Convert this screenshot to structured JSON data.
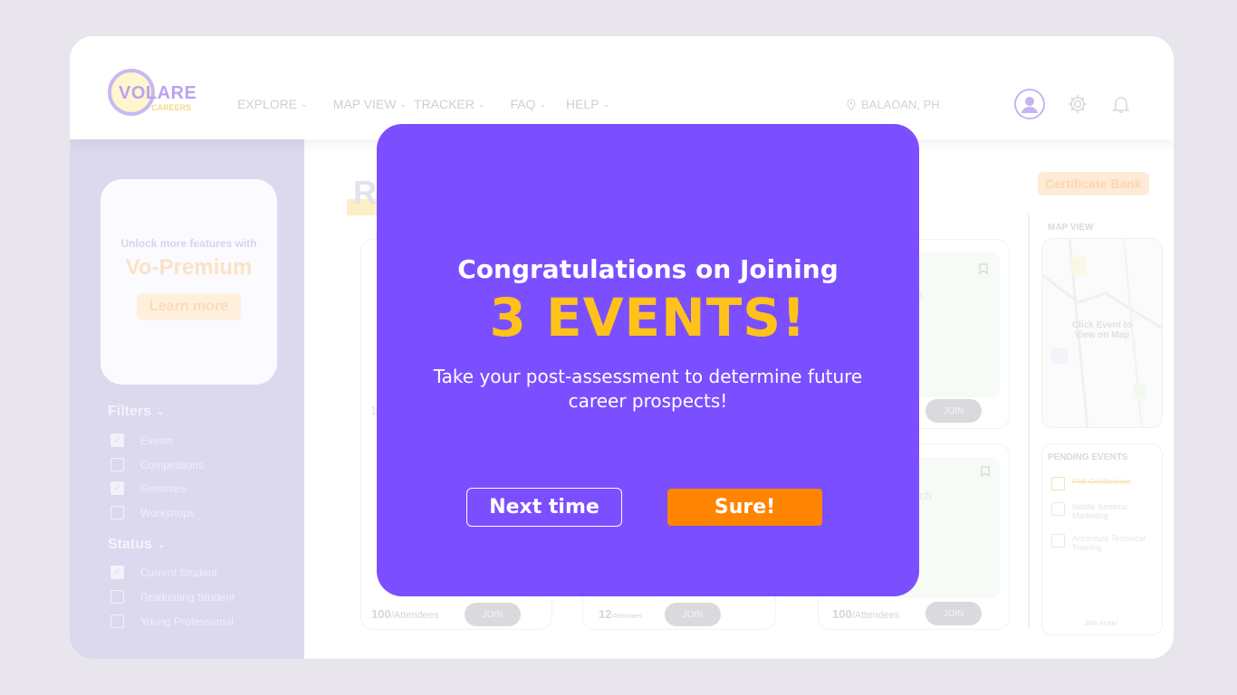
{
  "brand": {
    "name": "VOLARE",
    "sub": "CAREERS"
  },
  "nav": [
    {
      "label": "EXPLORE"
    },
    {
      "label": "MAP VIEW"
    },
    {
      "label": "TRACKER"
    },
    {
      "label": "FAQ"
    },
    {
      "label": "HELP"
    }
  ],
  "location": "BALAOAN, PH",
  "header_icons": [
    "user-icon",
    "gear-icon",
    "bell-icon"
  ],
  "promo": {
    "unlock": "Unlock more features with",
    "premium": "Vo-Premium",
    "learn": "Learn more"
  },
  "filters": {
    "title": "Filters",
    "options": [
      {
        "label": "Events",
        "checked": true
      },
      {
        "label": "Competitions",
        "checked": false
      },
      {
        "label": "Seminars",
        "checked": true
      },
      {
        "label": "Workshops",
        "checked": false
      }
    ]
  },
  "status": {
    "title": "Status",
    "options": [
      {
        "label": "Current Student",
        "checked": true
      },
      {
        "label": "Graduating Student",
        "checked": false
      },
      {
        "label": "Young Professional",
        "checked": false
      }
    ]
  },
  "main": {
    "title_letter": "R",
    "cards": [
      {
        "attendees": "100",
        "unit": "/Attendees",
        "join": "JOIN"
      },
      {
        "attendees": "12",
        "unit": "/Attendees",
        "join": "JOIN"
      },
      {
        "attendees": "100",
        "unit": "/Attendees",
        "join": "JOIN"
      },
      {
        "join": "JOIN"
      }
    ],
    "card_fragments": {
      "partial_1": "1",
      "partial_2": "s",
      "partial_3": "ch"
    }
  },
  "right_panel": {
    "certificate": "Certificate Bank",
    "map_label": "MAP VIEW",
    "map_hint": "Click Event to View on Map",
    "pending_label": "PENDING EVENTS",
    "pending": [
      {
        "label": "Pldt Conference",
        "checked": true
      },
      {
        "label": "Nestle Seminar Marketing",
        "checked": false
      },
      {
        "label": "Accenture Technical Training",
        "checked": false
      }
    ],
    "join_more": "Join more!"
  },
  "modal": {
    "title": "Congratulations on Joining",
    "count": "3 EVENTS!",
    "description": "Take your post-assessment to determine future career prospects!",
    "secondary": "Next time",
    "primary": "Sure!"
  },
  "colors": {
    "modal_bg": "#7b4fff",
    "accent_yellow": "#ffc21a",
    "primary_button": "#ff8402",
    "sidebar_bg": "#dcd8ee"
  }
}
